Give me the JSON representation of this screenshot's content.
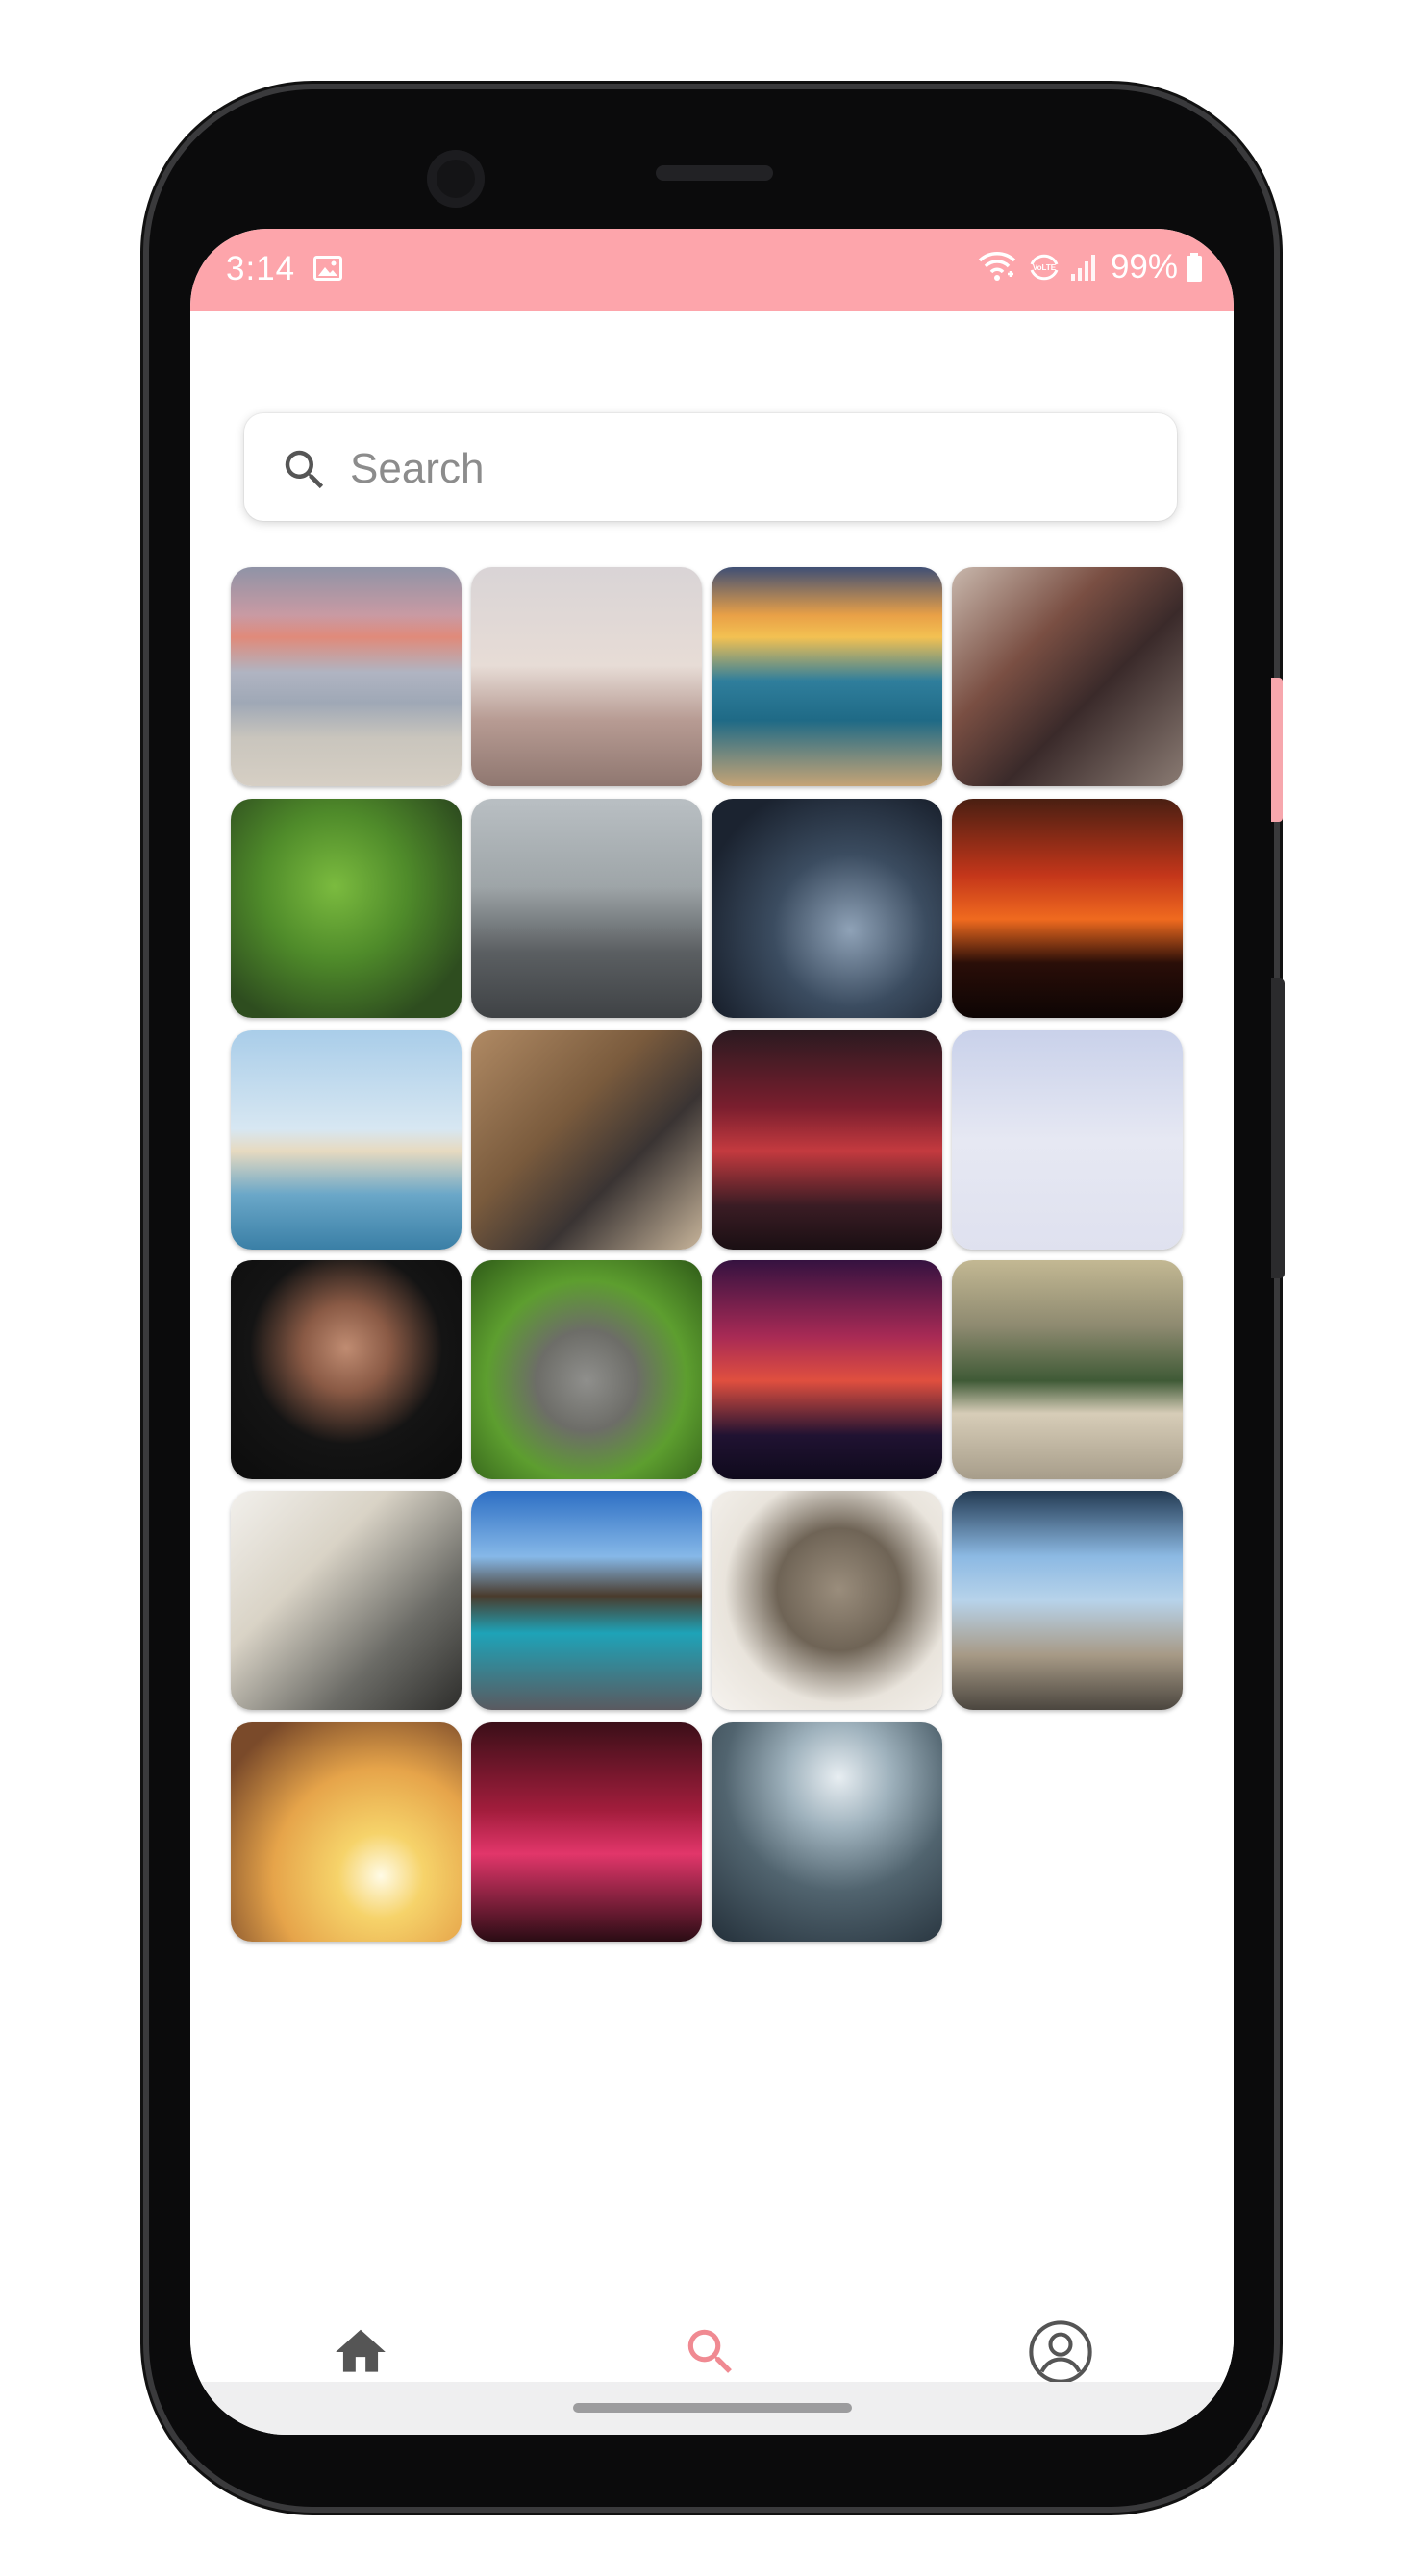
{
  "status_bar": {
    "time": "3:14",
    "battery": "99%",
    "background_color": "#fda5ab",
    "left_icons": [
      "image-icon"
    ],
    "right_icons": [
      "wifi-calling-icon",
      "volte-icon",
      "signal-icon",
      "battery-icon"
    ]
  },
  "search": {
    "placeholder": "Search",
    "value": "",
    "icon": "search-icon"
  },
  "gallery": {
    "items": [
      {
        "name": "photo-beach-palm-sunset-clouds"
      },
      {
        "name": "photo-woman-sitting-on-rock"
      },
      {
        "name": "photo-ocean-waves-sunset"
      },
      {
        "name": "photo-bookstore-stacks"
      },
      {
        "name": "photo-moss-statues"
      },
      {
        "name": "photo-vintage-motorcycle"
      },
      {
        "name": "photo-city-road-through-fence"
      },
      {
        "name": "photo-cyclist-silhouette-sunset"
      },
      {
        "name": "photo-sailing-ship"
      },
      {
        "name": "photo-vintage-cameras-map"
      },
      {
        "name": "photo-neon-city-street-night"
      },
      {
        "name": "photo-arctic-fox-snow"
      },
      {
        "name": "photo-woman-in-niqab"
      },
      {
        "name": "photo-kitten-grass"
      },
      {
        "name": "photo-tree-at-sunset"
      },
      {
        "name": "photo-woman-on-pier-lake"
      },
      {
        "name": "photo-woman-white-horse"
      },
      {
        "name": "photo-overwater-bungalows"
      },
      {
        "name": "photo-hedgehog"
      },
      {
        "name": "photo-tropical-beach-palms"
      },
      {
        "name": "photo-woman-silhouette-sunset"
      },
      {
        "name": "photo-rainy-neon-alley-umbrella"
      },
      {
        "name": "photo-elephant-in-forest"
      }
    ]
  },
  "bottom_nav": {
    "items": [
      {
        "icon": "home-icon",
        "active": false
      },
      {
        "icon": "search-icon",
        "active": true
      },
      {
        "icon": "account-icon",
        "active": false
      }
    ],
    "active_color": "#f08a92",
    "inactive_color": "#555555"
  }
}
